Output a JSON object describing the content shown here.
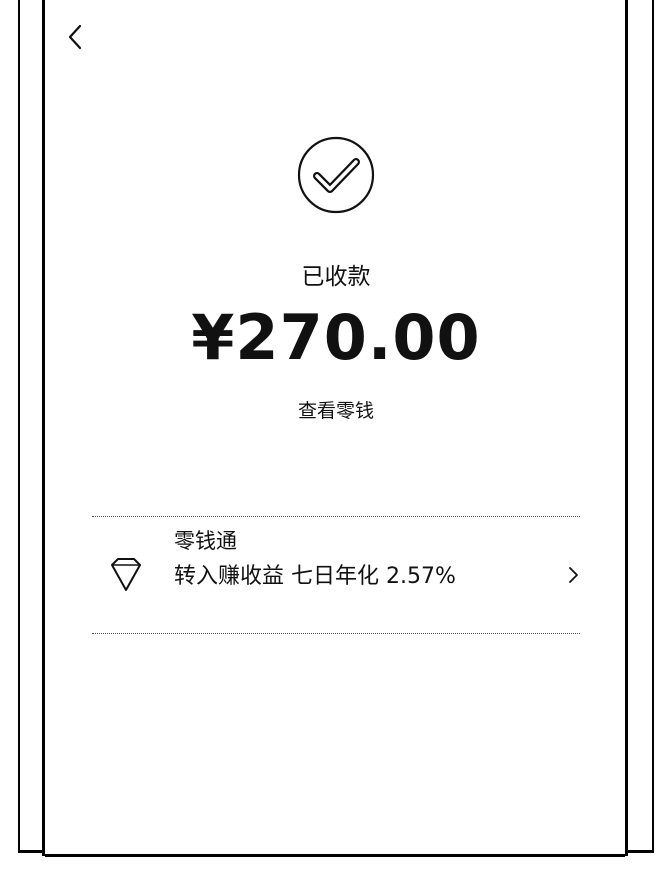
{
  "header": {
    "back_icon": "chevron-left-icon"
  },
  "result": {
    "status_icon": "check-circle-icon",
    "status_label": "已收款",
    "amount": "¥270.00",
    "view_change_link": "查看零钱"
  },
  "promo": {
    "icon": "diamond-icon",
    "title": "零钱通",
    "description": "转入赚收益 七日年化 2.57%",
    "chevron_icon": "chevron-right-icon"
  }
}
